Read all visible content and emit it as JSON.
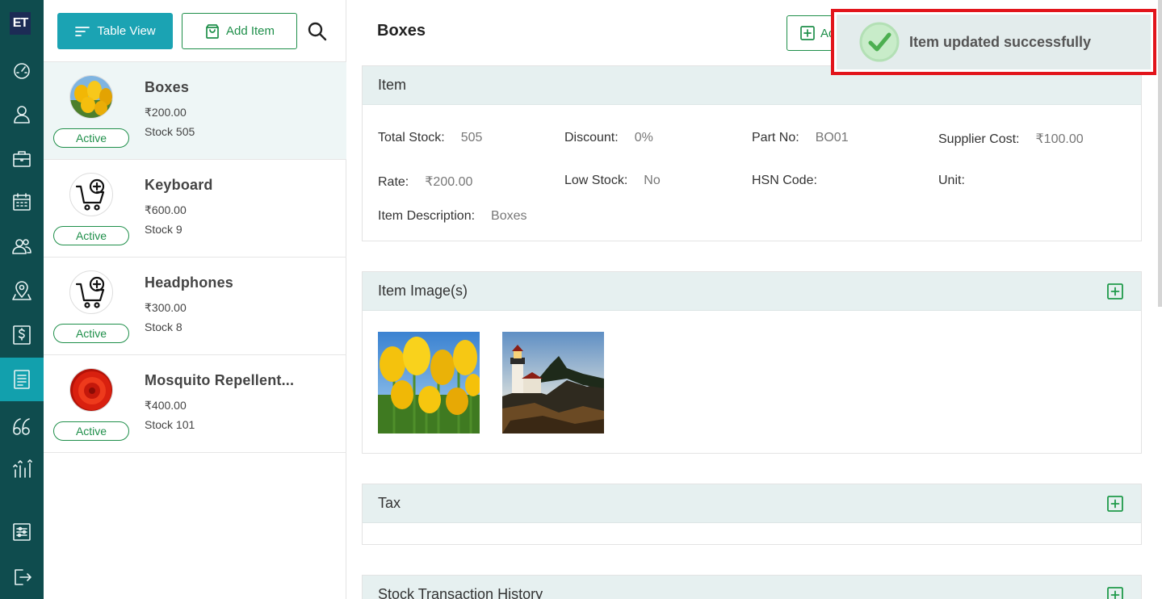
{
  "app": {
    "logo_text": "ET"
  },
  "rail": {
    "items": [
      "dashboard-icon",
      "user-icon",
      "briefcase-icon",
      "calendar-icon",
      "users-icon",
      "map-pin-icon",
      "dollar-icon",
      "list-icon",
      "quote-icon",
      "analytics-icon",
      "settings-icon",
      "logout-icon"
    ],
    "active_item": "list-icon"
  },
  "toolbar": {
    "table_view_label": "Table View",
    "add_item_label": "Add Item"
  },
  "items": [
    {
      "name": "Boxes",
      "price": "₹200.00",
      "stock": "Stock 505",
      "status": "Active",
      "image": "tulips"
    },
    {
      "name": "Keyboard",
      "price": "₹600.00",
      "stock": "Stock 9",
      "status": "Active",
      "image": "cart-icon"
    },
    {
      "name": "Headphones",
      "price": "₹300.00",
      "stock": "Stock 8",
      "status": "Active",
      "image": "cart-icon"
    },
    {
      "name": "Mosquito Repellent...",
      "price": "₹400.00",
      "stock": "Stock 101",
      "status": "Active",
      "image": "red-flower"
    }
  ],
  "detail": {
    "title": "Boxes",
    "header_button_label": "Ad",
    "item_section": {
      "title": "Item",
      "fields": {
        "total_stock": {
          "label": "Total Stock:",
          "value": "505"
        },
        "discount": {
          "label": "Discount:",
          "value": "0%"
        },
        "part_no": {
          "label": "Part No:",
          "value": "BO01"
        },
        "supplier_cost": {
          "label": "Supplier Cost:",
          "value": "₹100.00"
        },
        "rate": {
          "label": "Rate:",
          "value": "₹200.00"
        },
        "low_stock": {
          "label": "Low Stock:",
          "value": "No"
        },
        "hsn_code": {
          "label": "HSN Code:",
          "value": ""
        },
        "unit": {
          "label": "Unit:",
          "value": ""
        },
        "description": {
          "label": "Item Description:",
          "value": "Boxes"
        }
      }
    },
    "images_section": {
      "title": "Item Image(s)",
      "images": [
        "tulips",
        "lighthouse"
      ]
    },
    "tax_section": {
      "title": "Tax"
    },
    "stock_history_section": {
      "title": "Stock Transaction History"
    }
  },
  "toast": {
    "message": "Item updated successfully",
    "icon": "check-circle-icon"
  },
  "colors": {
    "rail_bg": "#0f4c4e",
    "rail_active": "#12a0ad",
    "accent_teal": "#1ba3b3",
    "success_green": "#1f8f4a",
    "toast_highlight": "#e2141b"
  }
}
